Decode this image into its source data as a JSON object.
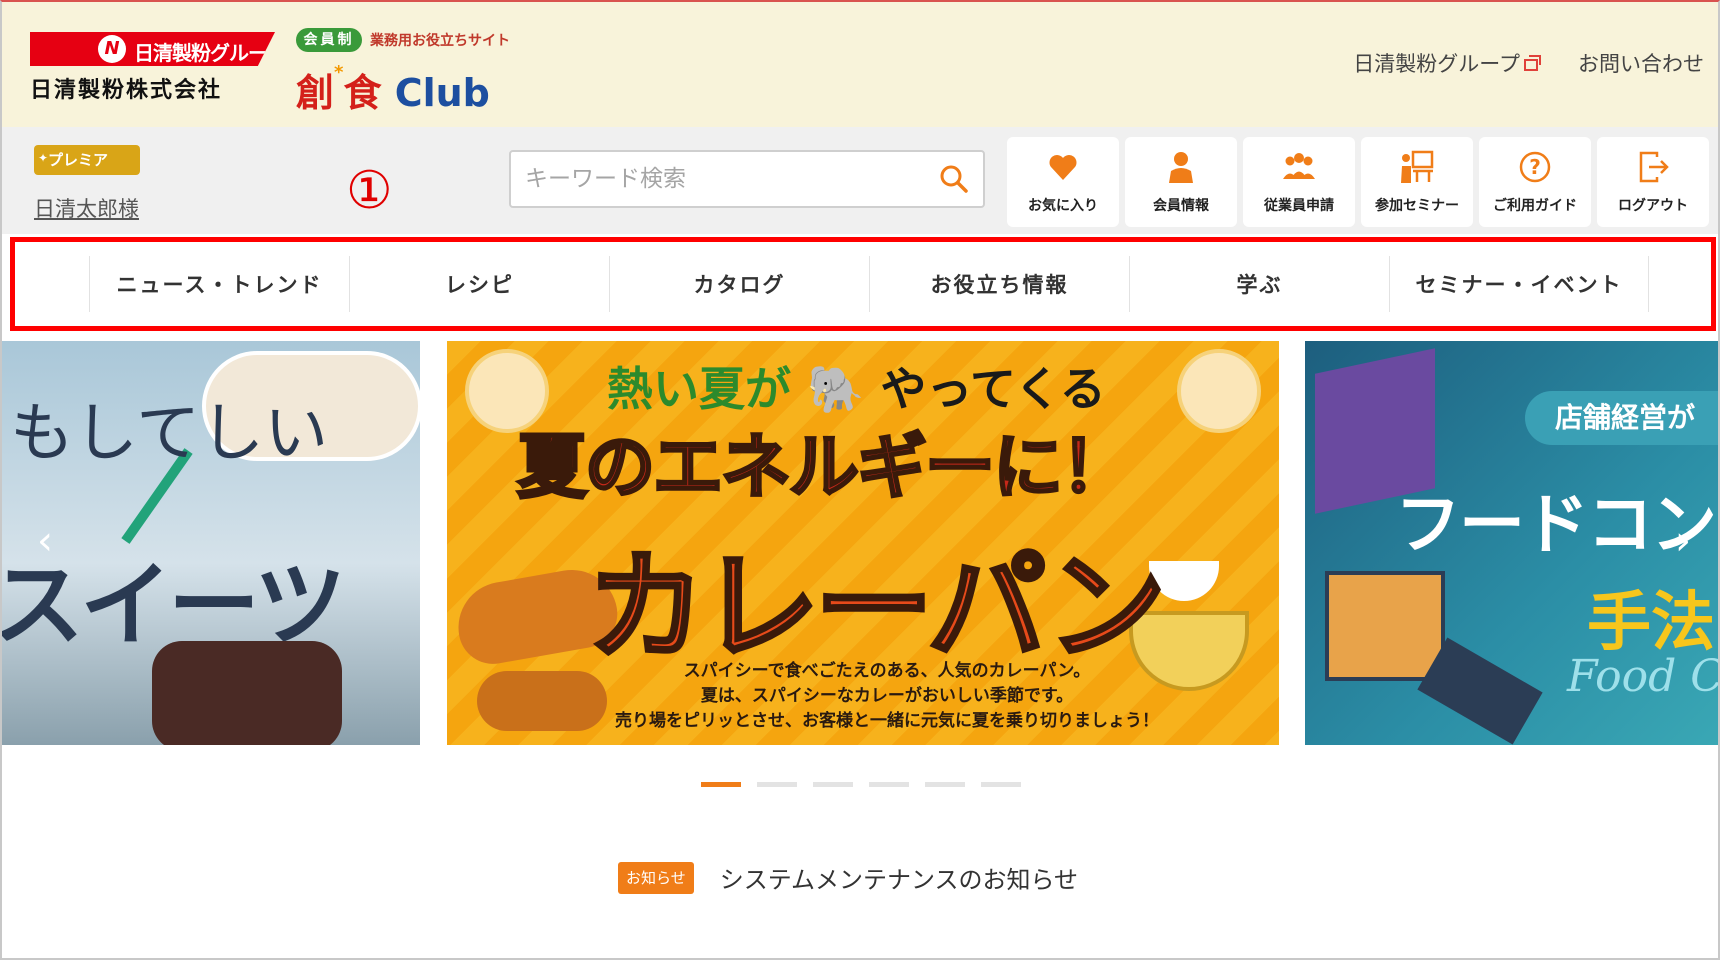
{
  "header": {
    "company_group_tag": "日清製粉グループ",
    "company_name": "日清製粉株式会社",
    "club_member_badge": "会員制",
    "club_tagline": "業務用お役立ちサイト",
    "club_name_part1": "創",
    "club_name_part2": "食",
    "club_name_part3": "Club",
    "links": [
      {
        "label": "日清製粉グループ"
      },
      {
        "label": "お問い合わせ"
      }
    ]
  },
  "user": {
    "membership_badge": "プレミア",
    "name": "日清太郎様"
  },
  "annotation_label": "①",
  "search": {
    "placeholder": "キーワード検索"
  },
  "icon_buttons": [
    {
      "label": "お気に入り",
      "icon": "heart-icon"
    },
    {
      "label": "会員情報",
      "icon": "person-icon"
    },
    {
      "label": "従業員申請",
      "icon": "group-icon"
    },
    {
      "label": "参加セミナー",
      "icon": "seminar-icon"
    },
    {
      "label": "ご利用ガイド",
      "icon": "help-icon"
    },
    {
      "label": "ログアウト",
      "icon": "logout-icon"
    }
  ],
  "nav": {
    "items": [
      {
        "label": "ニュース・トレンド"
      },
      {
        "label": "レシピ"
      },
      {
        "label": "カタログ"
      },
      {
        "label": "お役立ち情報"
      },
      {
        "label": "学ぶ"
      },
      {
        "label": "セミナー・イベント"
      }
    ]
  },
  "carousel": {
    "left_slide": {
      "text_small": "もしてしい",
      "text_large": "スイーツ"
    },
    "center_slide": {
      "headline_part1": "熱い夏が",
      "headline_part2": "やってくる",
      "subheadline": "夏のエネルギーに！",
      "title": "カレーパン",
      "description_lines": [
        "スパイシーで食べごたえのある、人気のカレーパン。",
        "夏は、スパイシーなカレーがおいしい季節です。",
        "売り場をピリッとさせ、お客様と一緒に元気に夏を乗り切りましょう！"
      ]
    },
    "right_slide": {
      "label": "店舗経営が",
      "title": "フードコンサ",
      "method": "手法",
      "script": "Food Con"
    },
    "total_slides": 6,
    "active_slide_index": 0
  },
  "notice": {
    "badge": "お知らせ",
    "text": "システムメンテナンスのお知らせ"
  },
  "colors": {
    "header_bg": "#f8f3da",
    "accent_orange": "#f07d18",
    "brand_red": "#e60012",
    "annotation_red": "#ff0000",
    "premium_gold": "#d9a517"
  }
}
